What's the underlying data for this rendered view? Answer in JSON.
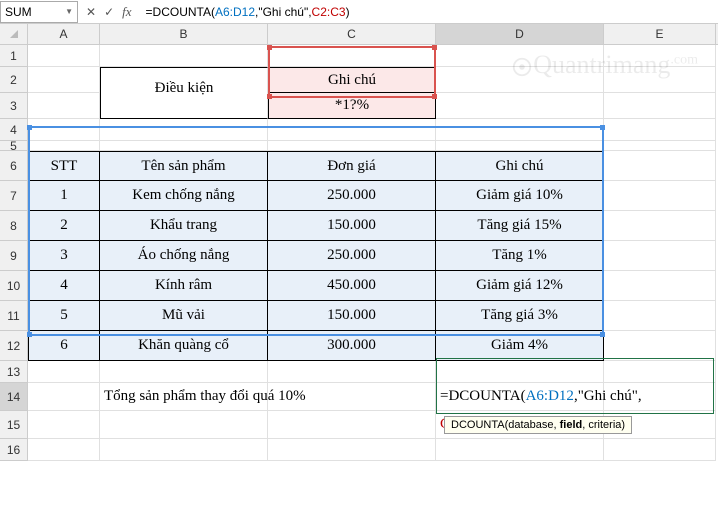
{
  "name_box": "SUM",
  "formula_bar": {
    "fx": "fx",
    "formula_plain": "=DCOUNTA(A6:D12,\"Ghi chú\",C2:C3)"
  },
  "columns": [
    "A",
    "B",
    "C",
    "D",
    "E"
  ],
  "rows": [
    "1",
    "2",
    "3",
    "4",
    "5",
    "6",
    "7",
    "8",
    "9",
    "10",
    "11",
    "12",
    "13",
    "14",
    "15",
    "16"
  ],
  "condition": {
    "label": "Điều kiện",
    "crit_header": "Ghi chú",
    "crit_value": "*1?%"
  },
  "table": {
    "headers": {
      "stt": "STT",
      "ten": "Tên sản phẩm",
      "gia": "Đơn giá",
      "ghi": "Ghi chú"
    },
    "rows": [
      {
        "stt": "1",
        "ten": "Kem chống nắng",
        "gia": "250.000",
        "ghi": "Giảm giá 10%"
      },
      {
        "stt": "2",
        "ten": "Khẩu trang",
        "gia": "150.000",
        "ghi": "Tăng giá 15%"
      },
      {
        "stt": "3",
        "ten": "Áo chống nắng",
        "gia": "250.000",
        "ghi": "Tăng 1%"
      },
      {
        "stt": "4",
        "ten": "Kính râm",
        "gia": "450.000",
        "ghi": "Giảm giá 12%"
      },
      {
        "stt": "5",
        "ten": "Mũ vải",
        "gia": "150.000",
        "ghi": "Tăng giá 3%"
      },
      {
        "stt": "6",
        "ten": "Khăn quàng cổ",
        "gia": "300.000",
        "ghi": "Giảm 4%"
      }
    ]
  },
  "summary_label": "Tổng sản phẩm thay đổi quá 10%",
  "active_formula": {
    "p1": "=DCOUNTA(",
    "p2": "A6:D12",
    "p3": ",\"Ghi chú\",",
    "p4": "C2:C3",
    "p5": ")"
  },
  "tooltip": {
    "fn": "DCOUNTA",
    "a1": "database",
    "a2": "field",
    "a3": "criteria"
  },
  "icons": {
    "cancel": "✕",
    "confirm": "✓"
  },
  "watermark": "Quantrimang"
}
